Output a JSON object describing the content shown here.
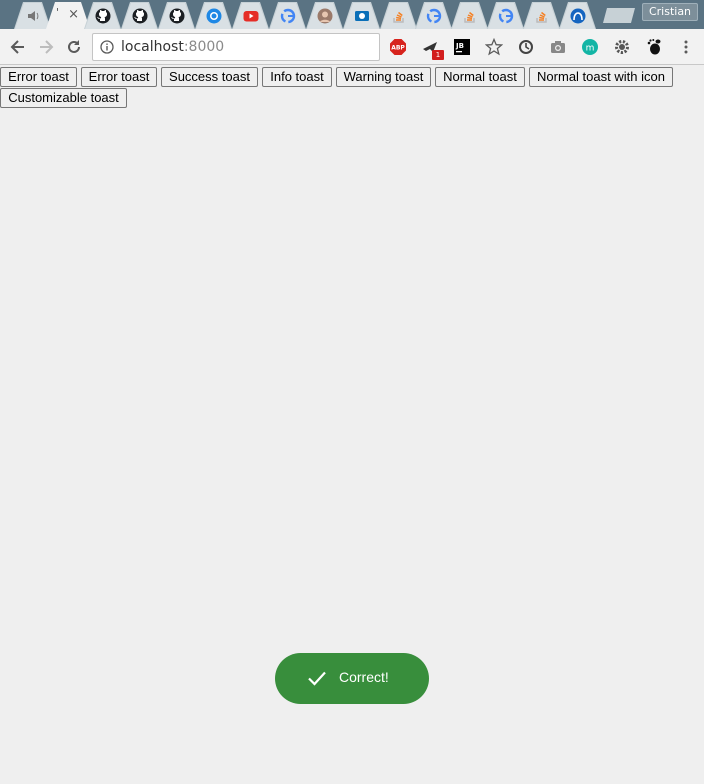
{
  "browser": {
    "profile_name": "Cristian",
    "tabs": [
      {
        "icon": "speaker-icon"
      },
      {
        "icon": "blank-page-icon",
        "active": true
      },
      {
        "icon": "github-icon"
      },
      {
        "icon": "github-icon"
      },
      {
        "icon": "github-icon"
      },
      {
        "icon": "chrome-circle-icon"
      },
      {
        "icon": "youtube-icon"
      },
      {
        "icon": "google-icon"
      },
      {
        "icon": "avatar-icon"
      },
      {
        "icon": "outlook-icon"
      },
      {
        "icon": "stackoverflow-icon"
      },
      {
        "icon": "google-icon"
      },
      {
        "icon": "stackoverflow-icon"
      },
      {
        "icon": "google-icon"
      },
      {
        "icon": "stackoverflow-icon"
      },
      {
        "icon": "arch-icon"
      }
    ],
    "close_glyph": "×",
    "url_host": "localhost",
    "url_port": ":8000",
    "ext_badge": "1"
  },
  "buttons": {
    "error_1": "Error toast",
    "error_2": "Error toast",
    "success": "Success toast",
    "info": "Info toast",
    "warning": "Warning toast",
    "normal": "Normal toast",
    "normal_icon": "Normal toast with icon",
    "custom": "Customizable toast"
  },
  "toast": {
    "message": "Correct!",
    "color": "#388e3c",
    "icon": "checkmark-icon"
  }
}
